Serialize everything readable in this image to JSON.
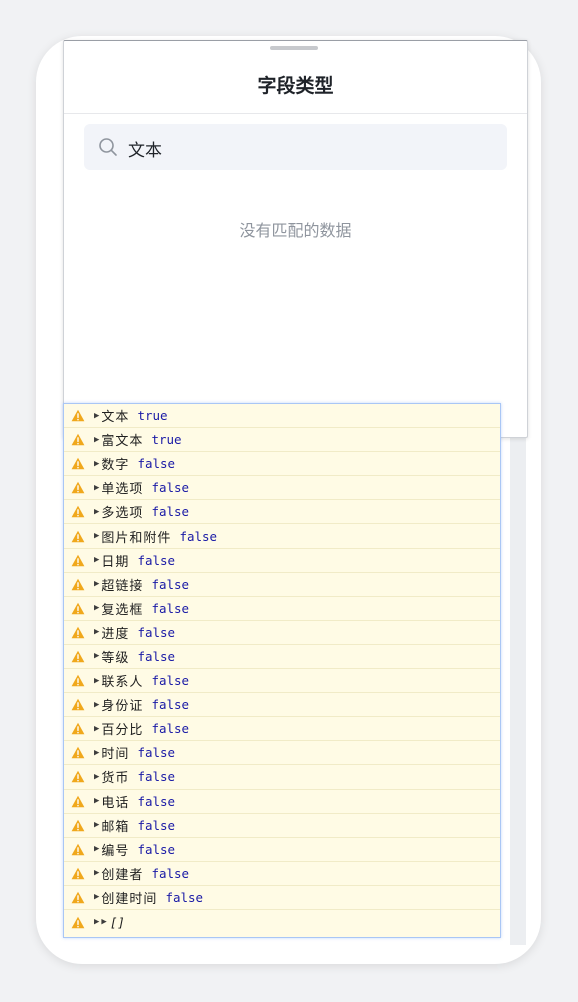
{
  "sheet": {
    "title": "字段类型",
    "search_value": "文本",
    "empty_text": "没有匹配的数据"
  },
  "console": {
    "rows": [
      {
        "key": "文本",
        "value": "true"
      },
      {
        "key": "富文本",
        "value": "true"
      },
      {
        "key": "数字",
        "value": "false"
      },
      {
        "key": "单选项",
        "value": "false"
      },
      {
        "key": "多选项",
        "value": "false"
      },
      {
        "key": "图片和附件",
        "value": "false"
      },
      {
        "key": "日期",
        "value": "false"
      },
      {
        "key": "超链接",
        "value": "false"
      },
      {
        "key": "复选框",
        "value": "false"
      },
      {
        "key": "进度",
        "value": "false"
      },
      {
        "key": "等级",
        "value": "false"
      },
      {
        "key": "联系人",
        "value": "false"
      },
      {
        "key": "身份证",
        "value": "false"
      },
      {
        "key": "百分比",
        "value": "false"
      },
      {
        "key": "时间",
        "value": "false"
      },
      {
        "key": "货币",
        "value": "false"
      },
      {
        "key": "电话",
        "value": "false"
      },
      {
        "key": "邮箱",
        "value": "false"
      },
      {
        "key": "编号",
        "value": "false"
      },
      {
        "key": "创建者",
        "value": "false"
      },
      {
        "key": "创建时间",
        "value": "false"
      }
    ],
    "last_row": "[]"
  },
  "colors": {
    "console_bg": "#fffbe5",
    "warning_icon": "#f0a81c",
    "boolean_value": "#1a1aa6",
    "search_bg": "#f2f4f9"
  },
  "icons": {
    "search": "search-icon",
    "warning": "warning-icon",
    "expand": "expand-triangle-icon"
  }
}
